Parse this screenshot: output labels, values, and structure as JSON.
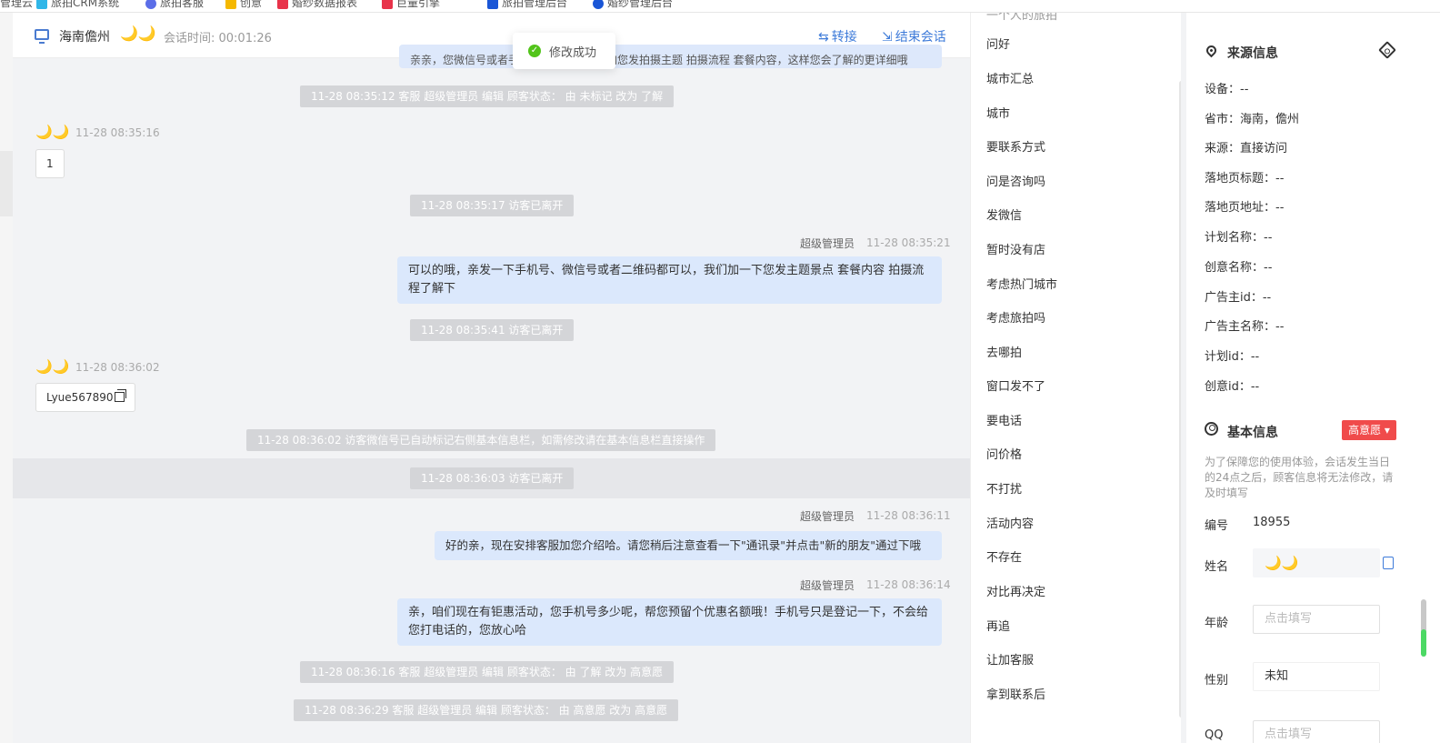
{
  "chat_header": {
    "location": "海南儋州",
    "visitor_name": "🌙🌙",
    "session_time_label": "会话时间: 00:01:26",
    "transfer_label": "转接",
    "end_label": "结束会话"
  },
  "toast": {
    "text": "修改成功"
  },
  "messages": {
    "cut_bubble": "亲亲，您微信号或者手机号都可以，我们加您发拍摄主题 拍摄流程 套餐内容，这样您会了解的更详细哦",
    "sys1": "11-28 08:35:12 客服 超级管理员 编辑 顾客状态： 由 未标记 改为 了解",
    "visitor1_name": "🌙🌙",
    "visitor1_time": "11-28 08:35:16",
    "visitor1_text": "1",
    "sys2": "11-28 08:35:17 访客已离开",
    "agent1_name": "超级管理员",
    "agent1_time": "11-28 08:35:21",
    "agent1_text": "可以的哦，亲发一下手机号、微信号或者二维码都可以，我们加一下您发主题景点 套餐内容 拍摄流程了解下",
    "sys3": "11-28 08:35:41 访客已离开",
    "visitor2_name": "🌙🌙",
    "visitor2_time": "11-28 08:36:02",
    "visitor2_text": "Lyue567890",
    "sys4": "11-28 08:36:02 访客微信号已自动标记右侧基本信息栏，如需修改请在基本信息栏直接操作",
    "sys5": "11-28 08:36:03 访客已离开",
    "agent2_name": "超级管理员",
    "agent2_time": "11-28 08:36:11",
    "agent2_text": "好的亲，现在安排客服加您介绍哈。请您稍后注意查看一下\"通讯录\"并点击\"新的朋友\"通过下哦",
    "agent3_name": "超级管理员",
    "agent3_time": "11-28 08:36:14",
    "agent3_text": "亲，咱们现在有钜惠活动，您手机号多少呢，帮您预留个优惠名额哦！手机号只是登记一下，不会给您打电话的，您放心哈",
    "sys6": "11-28 08:36:16 客服 超级管理员 编辑 顾客状态： 由 了解 改为 高意愿",
    "sys7": "11-28 08:36:29 客服 超级管理员 编辑 顾客状态： 由 高意愿 改为 高意愿"
  },
  "quick_replies": {
    "cut_top": "一个人的旅拍",
    "items": [
      "问好",
      "城市汇总",
      "城市",
      "要联系方式",
      "问是咨询吗",
      "发微信",
      "暂时没有店",
      "考虑热门城市",
      "考虑旅拍吗",
      "去哪拍",
      "窗口发不了",
      "要电话",
      "问价格",
      "不打扰",
      "活动内容",
      "不存在",
      "对比再决定",
      "再追",
      "让加客服",
      "拿到联系后"
    ]
  },
  "source_info": {
    "title": "来源信息",
    "fields": [
      "设备：--",
      "省市：海南，儋州",
      "来源：直接访问",
      "落地页标题：--",
      "落地页地址：--",
      "计划名称：--",
      "创意名称：--",
      "广告主id：--",
      "广告主名称：--",
      "计划id：--",
      "创意id：--"
    ]
  },
  "basic_info": {
    "title": "基本信息",
    "intent_label": "高意愿",
    "note": "为了保障您的使用体验，会话发生当日的24点之后，顾客信息将无法修改，请及时填写",
    "id_label": "编号",
    "id_value": "18955",
    "name_label": "姓名",
    "name_value": "🌙🌙",
    "age_label": "年龄",
    "age_placeholder": "点击填写",
    "gender_label": "性别",
    "gender_value": "未知",
    "qq_label": "QQ",
    "qq_placeholder": "点击填写"
  },
  "colors": {
    "accent": "#3e7bd9",
    "intent_red": "#f04b4b",
    "agent_bubble": "#dbe8fc",
    "system_pill": "#d4d5d8"
  }
}
